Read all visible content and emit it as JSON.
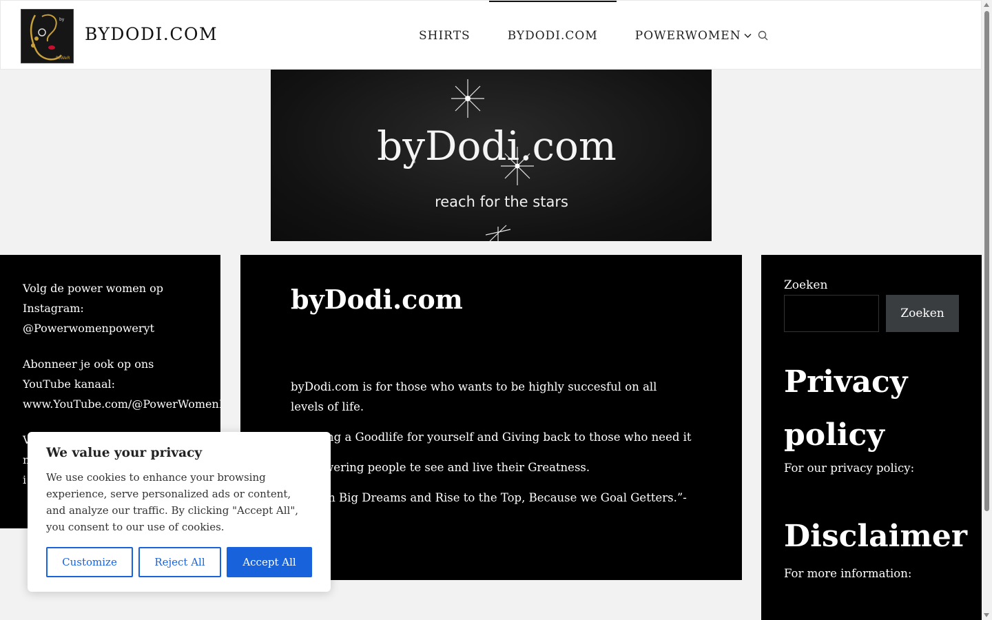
{
  "header": {
    "site_title": "BYDODI.COM",
    "nav": [
      {
        "label": "SHIRTS"
      },
      {
        "label": "BYDODI.COM"
      },
      {
        "label": "POWERWOMEN"
      }
    ]
  },
  "hero": {
    "title": "byDodi.com",
    "subtitle": "reach for the stars"
  },
  "left_sidebar": {
    "p1": "Volg de power women op Instagram: @Powerwomenpoweryt",
    "p1_line1": "Volg de power women op",
    "p1_line2": "Instagram:",
    "p1_line3": "@Powerwomenpoweryt",
    "p2_line1": "Abonneer je ook op ons",
    "p2_line2": "YouTube kanaal:",
    "p2_line3": "www.YouTube.com/@PowerWomenPowerYT",
    "p3_line1": "V",
    "p3_line2": "n",
    "p3_line3": "i"
  },
  "main": {
    "title": "byDodi.com",
    "p1": "byDodi.com is for those who wants to be highly succesful on all levels of life.",
    "p2": "Creating a Goodlife for yourself and Giving back to those who need it",
    "p3": "Empowering people te see and live their Greatness.",
    "p4": "“Dream Big Dreams and Rise to the Top, Because we Goal Getters.”- Dodi –"
  },
  "right_sidebar": {
    "search_label": "Zoeken",
    "search_button": "Zoeken",
    "privacy_title": "Privacy policy",
    "privacy_text": "For our privacy policy:",
    "disclaimer_title": "Disclaimer",
    "disclaimer_text": "For more information:"
  },
  "cookie_banner": {
    "title": "We value your privacy",
    "text": "We use cookies to enhance your browsing experience, serve personalized ads or content, and analyze our traffic. By clicking \"Accept All\", you consent to our use of cookies.",
    "customize": "Customize",
    "reject": "Reject All",
    "accept": "Accept All"
  },
  "colors": {
    "accent": "#1863dc",
    "dark_panel": "#000000",
    "search_button_bg": "#3a3d40"
  }
}
